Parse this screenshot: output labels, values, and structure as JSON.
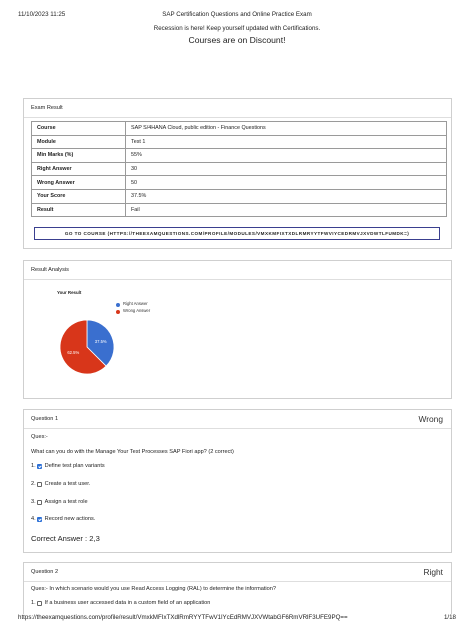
{
  "header": {
    "datetime": "11/10/2023 11:25",
    "title": "SAP Certification Questions and Online Practice Exam",
    "notice": "Recession is here! Keep yourself updated with Certifications.",
    "discount": "Courses are on Discount!"
  },
  "exam_result": {
    "heading": "Exam Result",
    "rows": [
      {
        "label": "Course",
        "value": "SAP S/4HANA Cloud, public edition - Finance Questions"
      },
      {
        "label": "Module",
        "value": "Test 1"
      },
      {
        "label": "Min Marks (%)",
        "value": "55%"
      },
      {
        "label": "Right Answer",
        "value": "30"
      },
      {
        "label": "Wrong Answer",
        "value": "50"
      },
      {
        "label": "Your Score",
        "value": "37.5%"
      },
      {
        "label": "Result",
        "value": "Fail"
      }
    ],
    "go_button": "GO TO COURSE (HTTPS://THEEXAMQUESTIONS.COM/PROFILE/MODULES/VMXKMFIXTXDLRMRYYTFWVIYCEDRMVJXVDWTLFUMDK=)"
  },
  "result_analysis": {
    "heading": "Result Analysis",
    "chart_data": {
      "type": "pie",
      "title": "Your Result",
      "series": [
        {
          "name": "Right Answer",
          "value": 37.5,
          "label": "37.5%",
          "color": "#3a6fcf"
        },
        {
          "name": "Wrong Answer",
          "value": 62.5,
          "label": "62.5%",
          "color": "#d8361a"
        }
      ],
      "legend_position": "right"
    }
  },
  "question1": {
    "heading": "Question 1",
    "result": "Wrong",
    "ques_label": "Ques:-",
    "text": "What can you do with the Manage Your Test Processes SAP Fiori app? (2 correct)",
    "options": [
      {
        "num": "1.",
        "text": "Define test plan variants",
        "checked": true
      },
      {
        "num": "2.",
        "text": "Create a test user.",
        "checked": false
      },
      {
        "num": "3.",
        "text": "Assign a test role",
        "checked": false
      },
      {
        "num": "4.",
        "text": "Record new actions.",
        "checked": true
      }
    ],
    "correct": "Correct Answer : 2,3"
  },
  "question2": {
    "heading": "Question 2",
    "result": "Right",
    "text": "Ques:- In which scenario would you use Read Access Logging (RAL) to determine the information?",
    "options": [
      {
        "num": "1.",
        "text": "If a business user accessed data in a custom field of an application",
        "checked": false
      }
    ]
  },
  "footer": {
    "url": "https://theexamquestions.com/profile/result/VmxkMFIxTXdlRmRYYTFwV1lYcEdRMVJXVWtabGF6RmVRlF3UFE9PQ==",
    "page": "1/18"
  }
}
